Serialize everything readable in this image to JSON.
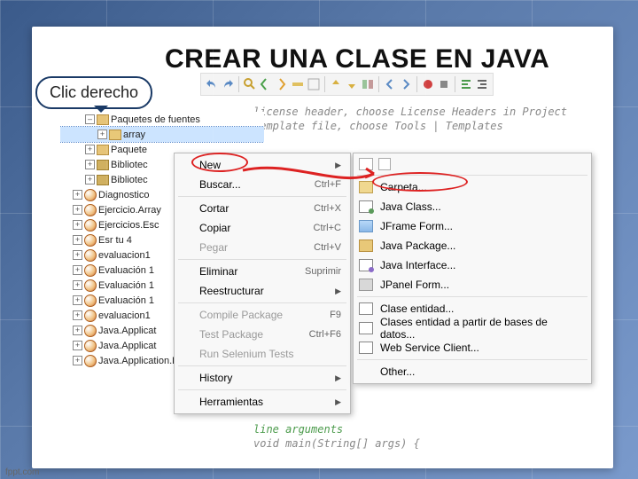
{
  "title": "CREAR UNA CLASE EN JAVA",
  "callout": "Clic derecho",
  "footer": "fppt.com",
  "tree": {
    "root_expanded_label": "Paquetes de fuentes",
    "selected_pkg": "array",
    "siblings": [
      "Paquete",
      "Bibliotec",
      "Bibliotec"
    ],
    "projects": [
      "Diagnostico",
      "Ejercicio.Array",
      "Ejercicios.Esc",
      "Esr tu 4",
      "evaluacion1",
      "Evaluación 1",
      "Evaluación 1",
      "Evaluación 1",
      "evaluacion1",
      "Java.Applicat",
      "Java.Applicat",
      "Java.Application.Ejemplo"
    ]
  },
  "code_top": {
    "l1": "license header, choose License Headers in Project",
    "l2": "template file, choose Tools | Templates"
  },
  "code_bottom": {
    "l1": "line arguments",
    "l2": "void main(String[] args) {"
  },
  "context_menu": [
    {
      "label": "New",
      "shortcut": "",
      "arrow": true,
      "icon": ""
    },
    {
      "label": "Buscar...",
      "shortcut": "Ctrl+F",
      "icon": ""
    },
    {
      "sep": true
    },
    {
      "label": "Cortar",
      "shortcut": "Ctrl+X",
      "icon": ""
    },
    {
      "label": "Copiar",
      "shortcut": "Ctrl+C",
      "icon": ""
    },
    {
      "label": "Pegar",
      "shortcut": "Ctrl+V",
      "disabled": true,
      "icon": ""
    },
    {
      "sep": true
    },
    {
      "label": "Eliminar",
      "shortcut": "Suprimir",
      "icon": ""
    },
    {
      "label": "Reestructurar",
      "shortcut": "",
      "arrow": true,
      "icon": ""
    },
    {
      "sep": true
    },
    {
      "label": "Compile Package",
      "shortcut": "F9",
      "disabled": true,
      "icon": ""
    },
    {
      "label": "Test Package",
      "shortcut": "Ctrl+F6",
      "disabled": true,
      "icon": ""
    },
    {
      "label": "Run Selenium Tests",
      "shortcut": "",
      "disabled": true,
      "icon": ""
    },
    {
      "sep": true
    },
    {
      "label": "History",
      "shortcut": "",
      "arrow": true,
      "icon": ""
    },
    {
      "sep": true
    },
    {
      "label": "Herramientas",
      "shortcut": "",
      "arrow": true,
      "icon": ""
    }
  ],
  "sub_menu": [
    {
      "label": "Carpeta...",
      "iconClass": "icon-folder"
    },
    {
      "label": "Java Class...",
      "iconClass": "icon-class"
    },
    {
      "label": "JFrame Form...",
      "iconClass": "icon-form"
    },
    {
      "label": "Java Package...",
      "iconClass": "icon-pkg"
    },
    {
      "label": "Java Interface...",
      "iconClass": "icon-iface"
    },
    {
      "label": "JPanel Form...",
      "iconClass": "icon-panel"
    },
    {
      "sep": true
    },
    {
      "label": "Clase entidad...",
      "iconClass": "icon-entity"
    },
    {
      "label": "Clases entidad a partir de bases de datos...",
      "iconClass": "icon-entity"
    },
    {
      "label": "Web Service Client...",
      "iconClass": "icon-ws"
    },
    {
      "sep": true
    },
    {
      "label": "Other...",
      "iconClass": ""
    }
  ],
  "toolbar_icons": [
    "undo",
    "redo",
    "sep",
    "find",
    "prev",
    "next",
    "mark",
    "clear",
    "sep",
    "up",
    "down",
    "diff",
    "sep",
    "back",
    "fwd",
    "sep",
    "rec",
    "stop",
    "sep",
    "format",
    "indent"
  ]
}
